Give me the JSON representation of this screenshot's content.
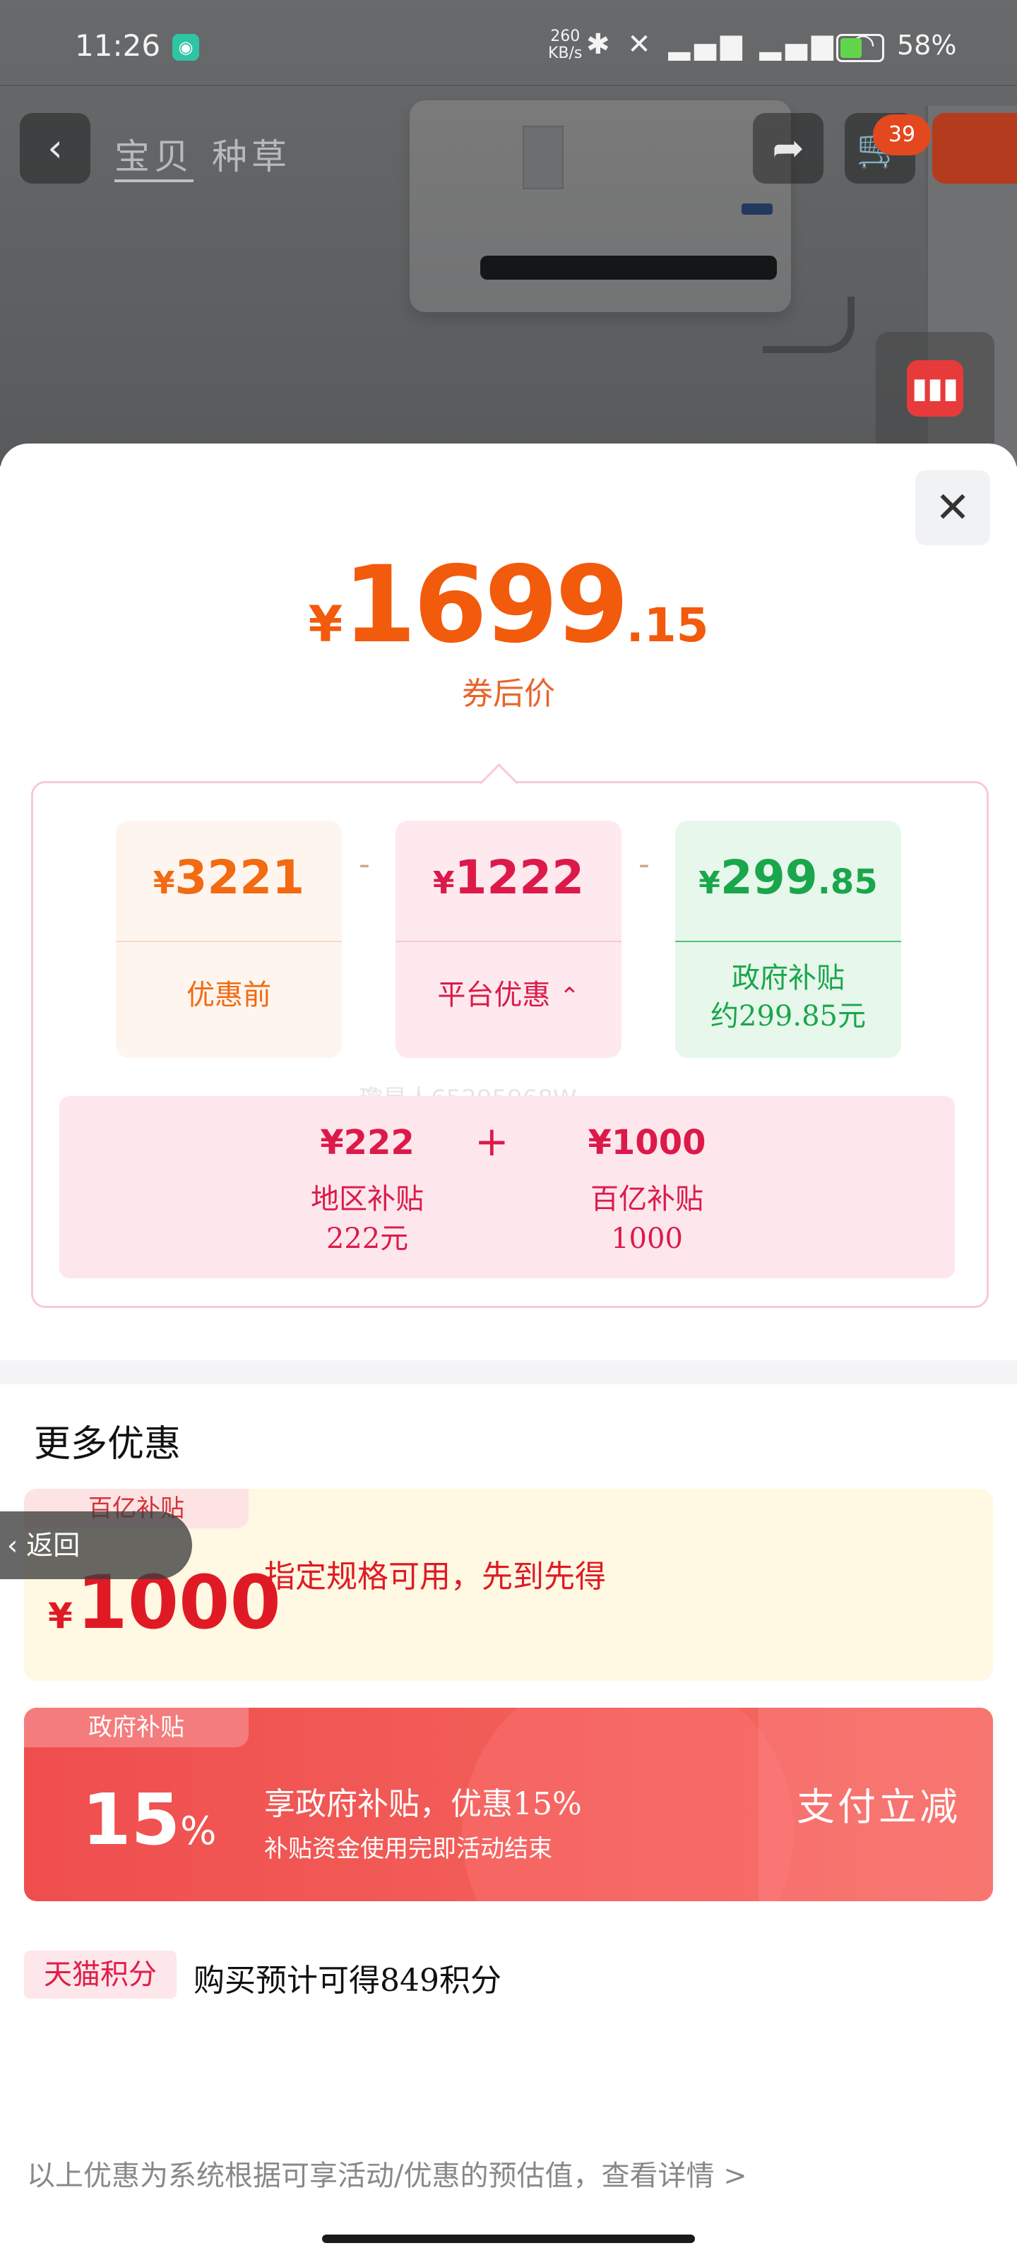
{
  "status_bar": {
    "time": "11:26",
    "net_speed": "260",
    "net_unit": "KB/s",
    "icons": "✱ 🔕 5G 5G",
    "battery": "58%"
  },
  "header": {
    "tabs": [
      "宝贝",
      "种草"
    ],
    "cart_badge": "39"
  },
  "price": {
    "currency": "¥",
    "integer": "1699",
    "decimal": ".15",
    "label": "券后价"
  },
  "breakdown": {
    "minus_sign": "-",
    "cards": [
      {
        "currency": "¥",
        "amount": "3221",
        "decimal": "",
        "label": "优惠前",
        "label2": ""
      },
      {
        "currency": "¥",
        "amount": "1222",
        "decimal": "",
        "label": "平台优惠",
        "label2": ""
      },
      {
        "currency": "¥",
        "amount": "299",
        "decimal": ".85",
        "label": "政府补贴",
        "label2": "约299.85元"
      }
    ],
    "expand_icon": "chevron-up",
    "watermark": "瓊星人65295968W",
    "sub": {
      "plus": "+",
      "items": [
        {
          "amount": "¥222",
          "name": "地区补贴",
          "detail": "222元"
        },
        {
          "amount": "¥1000",
          "name": "百亿补贴",
          "detail": "1000"
        }
      ]
    }
  },
  "more": {
    "title": "更多优惠",
    "promo1": {
      "tag": "百亿补贴",
      "currency": "¥",
      "amount": "1000",
      "desc": "指定规格可用，先到先得"
    },
    "promo2": {
      "tag": "政府补贴",
      "percent": "15",
      "percent_sign": "%",
      "desc": "享政府补贴，优惠15%",
      "note": "补贴资金使用完即活动结束",
      "cta": "支付立减"
    },
    "points": {
      "tag": "天猫积分",
      "text": "购买预计可得849积分"
    }
  },
  "back_button": {
    "label": "返回"
  },
  "footer": {
    "text": "以上优惠为系统根据可享活动/优惠的预估值，查看详情 >"
  },
  "colors": {
    "price_orange": "#f25a0c",
    "subsidy_red": "#dc1a4a",
    "gov_green": "#1aa64a",
    "promo_red": "#f04e4e"
  }
}
